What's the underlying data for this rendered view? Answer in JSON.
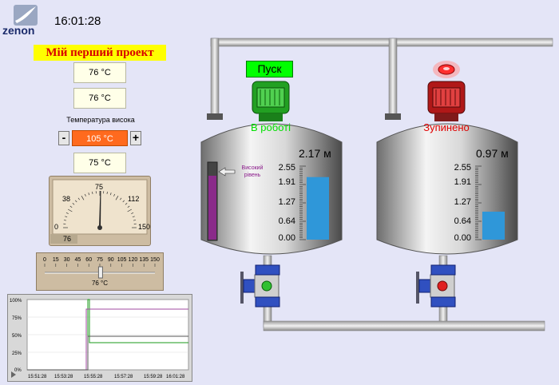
{
  "app": {
    "logo_text": "zenon",
    "clock": "16:01:28"
  },
  "project_title": "Мій перший проект",
  "temps": {
    "value1": "76 °C",
    "value2": "76 °C",
    "high_label": "Температура висока",
    "high_value": "105 °C",
    "value3": "75 °C"
  },
  "stepper": {
    "minus": "-",
    "plus": "+"
  },
  "gauge": {
    "value": 76,
    "min": 0,
    "max": 150,
    "ticks": [
      "0",
      "38",
      "75",
      "112",
      "150"
    ],
    "readout": "76"
  },
  "slider": {
    "value": 76,
    "min": 0,
    "max": 150,
    "ticks": [
      "0",
      "15",
      "30",
      "45",
      "60",
      "75",
      "90",
      "105",
      "120",
      "135",
      "150"
    ],
    "readout": "76 °C"
  },
  "trend": {
    "y_ticks": [
      "100%",
      "75%",
      "50%",
      "25%",
      "0%"
    ],
    "x_ticks": [
      "15:51:28",
      "15:53:28",
      "15:55:28",
      "15:57:28",
      "15:59:28",
      "16:01:28"
    ]
  },
  "tank1": {
    "button": "Пуск",
    "status": "В роботі",
    "level": "2.17 м",
    "level_value": 2.17,
    "scale": [
      "2.55",
      "1.91",
      "1.27",
      "0.64",
      "0.00"
    ],
    "alarm_label_1": "Високий",
    "alarm_label_2": "рівень"
  },
  "tank2": {
    "status": "Зупинено",
    "level": "0.97 м",
    "level_value": 0.97,
    "scale": [
      "2.55",
      "1.91",
      "1.27",
      "0.64",
      "0.00"
    ]
  },
  "colors": {
    "background": "#e4e5f7",
    "running": "#00e000",
    "stopped": "#e00000",
    "level_bar": "#2f97d9",
    "alarm_value": "#ff6a1e",
    "banner": "#ffff00"
  }
}
